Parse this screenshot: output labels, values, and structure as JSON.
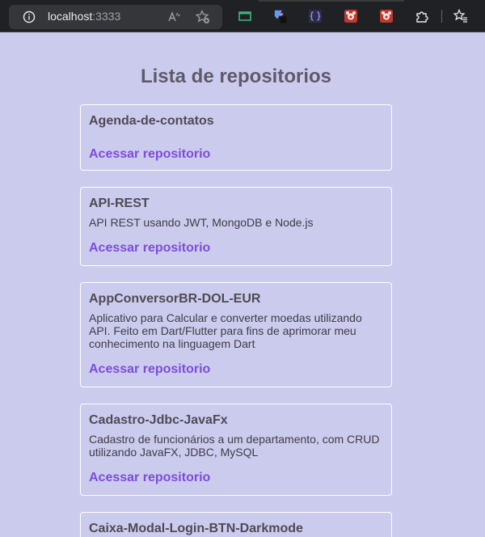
{
  "browser": {
    "url_host": "localhost",
    "url_port": ":3333"
  },
  "page": {
    "title": "Lista de repositorios"
  },
  "repos": [
    {
      "name": "Agenda-de-contatos",
      "description": "",
      "link": "Acessar repositorio"
    },
    {
      "name": "API-REST",
      "description": "API REST usando JWT, MongoDB e Node.js",
      "link": "Acessar repositorio"
    },
    {
      "name": "AppConversorBR-DOL-EUR",
      "description": "Aplicativo para Calcular e converter moedas utilizando API. Feito em Dart/Flutter para fins de aprimorar meu conhecimento na linguagem Dart",
      "link": "Acessar repositorio"
    },
    {
      "name": "Cadastro-Jdbc-JavaFx",
      "description": "Cadastro de funcionários a um departamento, com CRUD utilizando JavaFX, JDBC, MySQL",
      "link": "Acessar repositorio"
    },
    {
      "name": "Caixa-Modal-Login-BTN-Darkmode",
      "description": "",
      "link": ""
    }
  ],
  "colors": {
    "background": "#cbcbed",
    "title": "#5f5a6a",
    "link": "#7c4ddb",
    "card_border": "#ffffff"
  }
}
